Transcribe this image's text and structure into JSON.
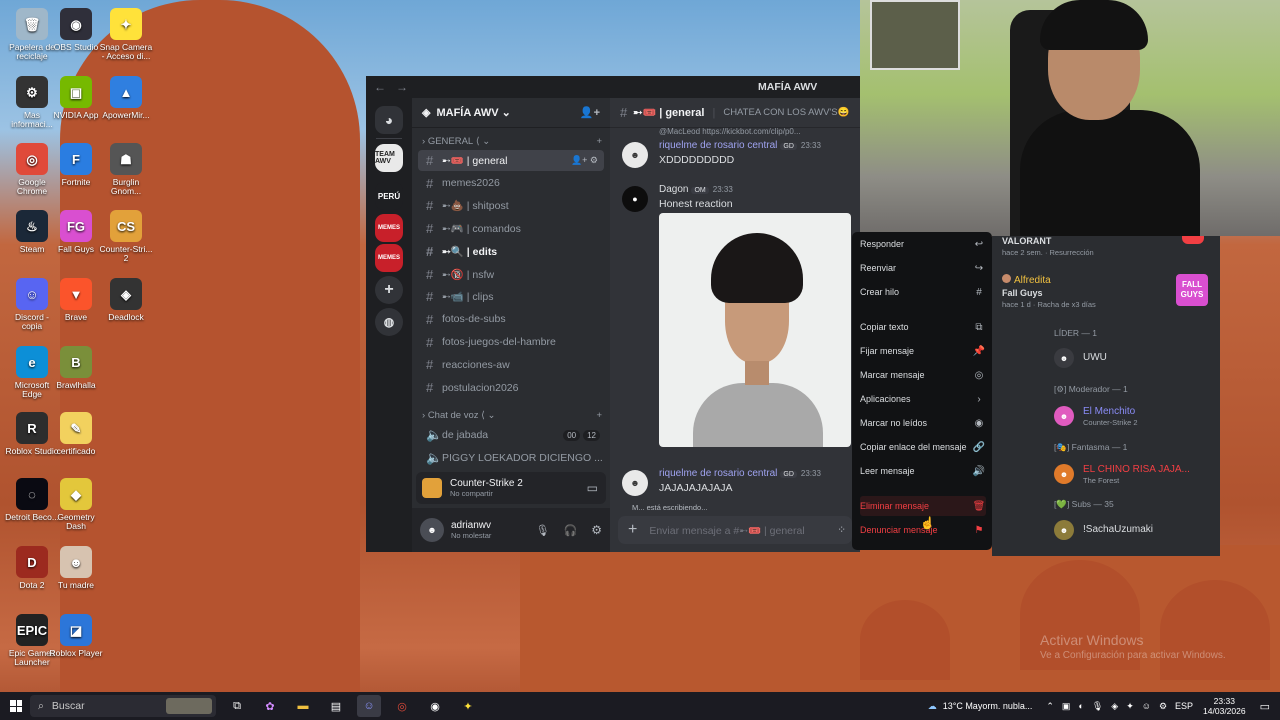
{
  "desktop": {
    "icons": [
      {
        "label": "Papelera de reciclaje",
        "color": "#9fb7c9",
        "glyph": "🗑"
      },
      {
        "label": "OBS Studio",
        "color": "#2f2f3a",
        "glyph": "◉"
      },
      {
        "label": "Snap Camera - Acceso di...",
        "color": "#ffe23a",
        "glyph": "✦"
      },
      {
        "label": "Mas informaci...",
        "color": "#333",
        "glyph": "⚙"
      },
      {
        "label": "NVIDIA App",
        "color": "#76b900",
        "glyph": "▣"
      },
      {
        "label": "ApowerMir...",
        "color": "#2f7fe0",
        "glyph": "▲"
      },
      {
        "label": "Google Chrome",
        "color": "#e04a3a",
        "glyph": "◎"
      },
      {
        "label": "Fortnite",
        "color": "#2a7de1",
        "glyph": "F"
      },
      {
        "label": "Burglin Gnom...",
        "color": "#555",
        "glyph": "☗"
      },
      {
        "label": "Steam",
        "color": "#1b2838",
        "glyph": "♨"
      },
      {
        "label": "Fall Guys",
        "color": "#d94fd0",
        "glyph": "FG"
      },
      {
        "label": "Counter-Stri... 2",
        "color": "#e2a13a",
        "glyph": "CS"
      },
      {
        "label": "Discord - copia",
        "color": "#5865f2",
        "glyph": "☺"
      },
      {
        "label": "Brave",
        "color": "#fb542b",
        "glyph": "▼"
      },
      {
        "label": "Deadlock",
        "color": "#333",
        "glyph": "◈"
      },
      {
        "label": "Microsoft Edge",
        "color": "#0c8fd7",
        "glyph": "e"
      },
      {
        "label": "Brawlhalla",
        "color": "#7a8f3a",
        "glyph": "B"
      },
      {
        "label": "Roblox Studio",
        "color": "#2d2d2d",
        "glyph": "R"
      },
      {
        "label": "certificado",
        "color": "#f2d15e",
        "glyph": "✎"
      },
      {
        "label": "Detroit Beco...",
        "color": "#0a0a12",
        "glyph": "◌"
      },
      {
        "label": "Geometry Dash",
        "color": "#e3c73b",
        "glyph": "◆"
      },
      {
        "label": "Dota 2",
        "color": "#9c2a1f",
        "glyph": "D"
      },
      {
        "label": "Tu madre",
        "color": "#d7c3b0",
        "glyph": "☻"
      },
      {
        "label": "Epic Games Launcher",
        "color": "#222",
        "glyph": "EPIC"
      },
      {
        "label": "Roblox Player",
        "color": "#2c76d9",
        "glyph": "◪"
      }
    ],
    "watermark_1": "Activar Windows",
    "watermark_2": "Ve a Configuración para activar Windows."
  },
  "discord": {
    "window_title": "MAFÍA AWV",
    "back_glyph": "←",
    "forward_glyph": "→",
    "guild_avatars": [
      "TEAM AWV",
      "PERÚ",
      "MEMES",
      "MEMES"
    ],
    "server": {
      "name": "MAFÍA AWV ⌄"
    },
    "categories": {
      "general": "GENERAL",
      "voice": "Chat de voz"
    },
    "channels": [
      {
        "name": "➸🎟️ | general"
      },
      {
        "name": "memes2026"
      },
      {
        "name": "➸💩 | shitpost"
      },
      {
        "name": "➸🎮 | comandos"
      },
      {
        "name": "➸🔍 | edits"
      },
      {
        "name": "➸🔞 | nsfw"
      },
      {
        "name": "➸📹 | clips"
      },
      {
        "name": "fotos-de-subs"
      },
      {
        "name": "fotos-juegos-del-hambre"
      },
      {
        "name": "reacciones-aw"
      },
      {
        "name": "postulacion2026"
      }
    ],
    "voice_channels": [
      {
        "name": "de jabada",
        "badge_a": "00",
        "badge_b": "12"
      },
      {
        "name": "PIGGY LOEKADOR DICIENGO ..."
      }
    ],
    "activity": {
      "game": "Counter-Strike 2",
      "sub": "No compartir"
    },
    "user": {
      "name": "adrianwv",
      "status": "No molestar"
    },
    "chat": {
      "channel": "➸🎟️ | general",
      "topic": "CHATEA CON LOS AWV'S😄",
      "link_fragment": "@MacLeod https://kickbot.com/clip/p0...",
      "messages": [
        {
          "author": "riquelme de rosario central",
          "tag": "GD",
          "time": "23:33",
          "text": "XDDDDDDDDD",
          "color": "#9fa3f0"
        },
        {
          "author": "Dagon",
          "tag": "OM",
          "time": "23:33",
          "text": "Honest reaction",
          "color": "#dbdee1"
        },
        {
          "author": "riquelme de rosario central",
          "tag": "GD",
          "time": "23:33",
          "text": "JAJAJAJAJAJA",
          "color": "#9fa3f0"
        }
      ],
      "typing": "M... está escribiendo...",
      "placeholder": "Enviar mensaje a #➸🎟️ | general"
    }
  },
  "context_menu": {
    "items": [
      {
        "label": "Responder",
        "icon": "↩"
      },
      {
        "label": "Reenviar",
        "icon": "↪"
      },
      {
        "label": "Crear hilo",
        "icon": "#"
      },
      {
        "label": "Copiar texto",
        "icon": "⧉"
      },
      {
        "label": "Fijar mensaje",
        "icon": "📌"
      },
      {
        "label": "Marcar mensaje",
        "icon": "◎"
      },
      {
        "label": "Aplicaciones",
        "icon": "›"
      },
      {
        "label": "Marcar no leídos",
        "icon": "◉"
      },
      {
        "label": "Copiar enlace del mensaje",
        "icon": "🔗"
      },
      {
        "label": "Leer mensaje",
        "icon": "🔊"
      },
      {
        "label": "Eliminar mensaje",
        "icon": "🗑"
      },
      {
        "label": "Denunciar mensaje",
        "icon": "⚑"
      }
    ]
  },
  "members": {
    "top_game": "VALORANT",
    "top_sub": "hace 2 sem. · Resurrección",
    "alfredita": {
      "name": "Alfredita",
      "game": "Fall Guys",
      "sub": "hace 1 d · Racha de x3 días",
      "logo": "FALL GUYS"
    },
    "groups": [
      {
        "title": "LÍDER — 1",
        "members": [
          {
            "name": "UWU",
            "sub": "",
            "color": "#dbdee1"
          }
        ]
      },
      {
        "title": "[⚙] Moderador — 1",
        "members": [
          {
            "name": "El Menchito",
            "sub": "Counter-Strike 2",
            "color": "#8a8cf7"
          }
        ]
      },
      {
        "title": "[🎭] Fantasma — 1",
        "members": [
          {
            "name": "EL CHINO RISA JAJA...",
            "sub": "The Forest",
            "color": "#f23f43"
          }
        ]
      },
      {
        "title": "[💚] Subs — 35",
        "members": [
          {
            "name": "!SachaUzumaki",
            "sub": "",
            "color": "#dbdee1"
          }
        ]
      }
    ]
  },
  "taskbar": {
    "search": "Buscar",
    "weather": "13°C  Mayorm. nubla...",
    "lang": "ESP",
    "time": "23:33",
    "date": "14/03/2026"
  }
}
